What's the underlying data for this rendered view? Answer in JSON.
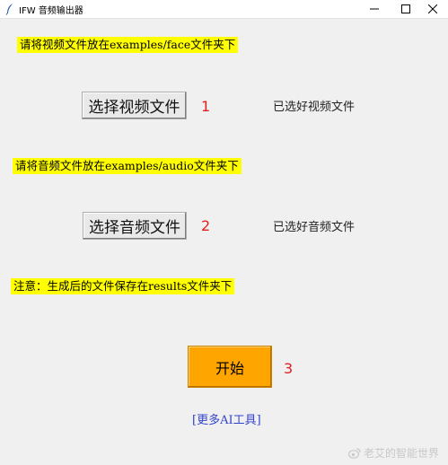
{
  "window": {
    "title": "IFW 音频输出器"
  },
  "notes": {
    "video_path": "请将视频文件放在examples/face文件夹下",
    "audio_path": "请将音频文件放在examples/audio文件夹下",
    "results_path": "注意：生成后的文件保存在results文件夹下"
  },
  "buttons": {
    "select_video": "选择视频文件",
    "select_audio": "选择音频文件",
    "start": "开始"
  },
  "step_numbers": {
    "one": "1",
    "two": "2",
    "three": "3"
  },
  "status": {
    "video": "已选好视频文件",
    "audio": "已选好音频文件"
  },
  "link": {
    "more_tools": "[更多AI工具]"
  },
  "watermark": {
    "text": "老艾的智能世界"
  },
  "colors": {
    "note_highlight": "#ffff00",
    "step_number": "#e02020",
    "start_button": "#ffa500",
    "link": "#3344cc"
  }
}
